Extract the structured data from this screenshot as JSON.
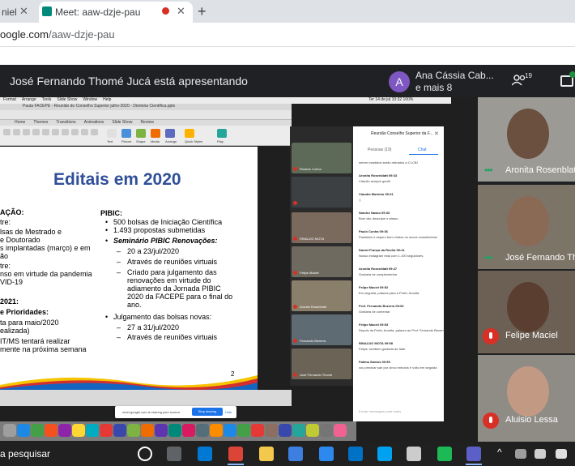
{
  "browser": {
    "prev_tab_label": "niel",
    "active_tab_label": "Meet: aaw-dzje-pau",
    "new_tab_symbol": "+",
    "close_symbol": "✕",
    "url_domain": "oogle.com",
    "url_path": "/aaw-dzje-pau"
  },
  "meet": {
    "presenting_text": "José Fernando Thomé Jucá está apresentando",
    "avatar_initial": "A",
    "participant_name": "Ana Cássia Cab...",
    "more_text": "e mais 8",
    "people_count": "19"
  },
  "presentation": {
    "mac_menu": [
      "Format",
      "Arrange",
      "Tools",
      "Slide Show",
      "Window",
      "Help"
    ],
    "mac_clock": "Ter 14 de jul  10:32  100%",
    "ppt_window_title": "Pauta FACEPE - Reunião do Conselho Superior julho-2020 - Diretoria Científica.pptx",
    "ppt_tabs": [
      "Home",
      "Themes",
      "Transitions",
      "Animations",
      "Slide Show",
      "Review"
    ],
    "ribbon_labels": [
      "Text",
      "Picture",
      "Shape",
      "Media",
      "Arrange",
      "Quick Styles",
      "Play"
    ],
    "slide": {
      "title": "Editais em 2020",
      "left_col": [
        "AÇÃO:",
        "tre:",
        "lsas de Mestrado e",
        "e Doutorado",
        "s implantadas (março) e em",
        "ão",
        "tre:",
        "nso em virtude da pandemia",
        "VID-19",
        "2021:",
        "e Prioridades:",
        "ta para maio/2020",
        "ealizada)",
        "IT/MS tentará realizar",
        "mente na próxima semana"
      ],
      "right_col": [
        "PIBIC:",
        "500 bolsas de Iniciação Científica",
        "1.493 propostas submetidas",
        "Seminário PIBIC Renovações:",
        "20 a 23/jul/2020",
        "Através de reuniões virtuais",
        "Criado para julgamento das",
        "renovações em virtude do",
        "adiamento da Jornada PIBIC",
        "2020 da FACEPE para o final do",
        "ano.",
        "Julgamento das bolsas novas:",
        "27 a 31/jul/2020",
        "Através de reuniões virtuais"
      ],
      "page_number": "2"
    },
    "share_notice": "meet.google.com is sharing your screen.",
    "stop_sharing_label": "Stop sharing",
    "hide_label": "Hide"
  },
  "inner_meet": {
    "avatar_initial": "R",
    "thumb_names": [
      "Ricardo Cunha",
      "RINALDO MOTA",
      "Felipe Maciel",
      "Aronita Rosenblatt",
      "Fernando Bezerra",
      "José Fernando Thomé"
    ],
    "chat_title": "Reunião Conselho Superior da F...",
    "tab_people": "Pessoas (19)",
    "tab_chat": "Chat",
    "input_placeholder": "Enviar mensagem para todos",
    "messages": [
      {
        "name": "",
        "text": "serem mantidos serão retirados a CI-CBI"
      },
      {
        "name": "Aronita Rosenblatt 09:33",
        "text": "Cláudio sempre gentil"
      },
      {
        "name": "Claudio Marinho 09:31",
        "text": ":)"
      },
      {
        "name": "Sandro Nasko 09:33",
        "text": "Bom dia, desculpe o atraso."
      },
      {
        "name": "Paulo Cunha 09:36",
        "text": "Parabéns e espero bem vindos os novos conselheiros!"
      },
      {
        "name": "Daniel França da Rocha 09:41",
        "text": "Nosso Instagram está com 1.100 seguidores"
      },
      {
        "name": "Aronita Rosenblatt 09:47",
        "text": "Gostaria de complementar"
      },
      {
        "name": "Felipe Maciel 09:52",
        "text": "Em seguida, palavra para a Profa. Aronita"
      },
      {
        "name": "Prof. Fernando Bezerra 09:52",
        "text": "Gostaria de comentar"
      },
      {
        "name": "Felipe Maciel 09:53",
        "text": "Depois da Profa. Aronita, palavra ao Prof. Fernando Bezerra"
      },
      {
        "name": "RINALDO MOTA 09:58",
        "text": "Felipe, também gostaria de falar"
      },
      {
        "name": "Fatima Santos 09:59",
        "text": "vou precisar sair por cinco minutos e volto em seguida"
      }
    ]
  },
  "tiles": [
    {
      "name": "Aronita Rosenblat",
      "muted": false
    },
    {
      "name": "José Fernando Th",
      "muted": false
    },
    {
      "name": "Felipe Maciel",
      "muted": true
    },
    {
      "name": "Aluisio Lessa",
      "muted": true
    }
  ],
  "taskbar": {
    "search_text": "a pesquisar"
  },
  "colors": {
    "accent": "#1a73e8",
    "meet_dark": "#202124",
    "slide_title": "#2f4f9a",
    "mute_red": "#d93025",
    "speaking_green": "#1ea362"
  }
}
